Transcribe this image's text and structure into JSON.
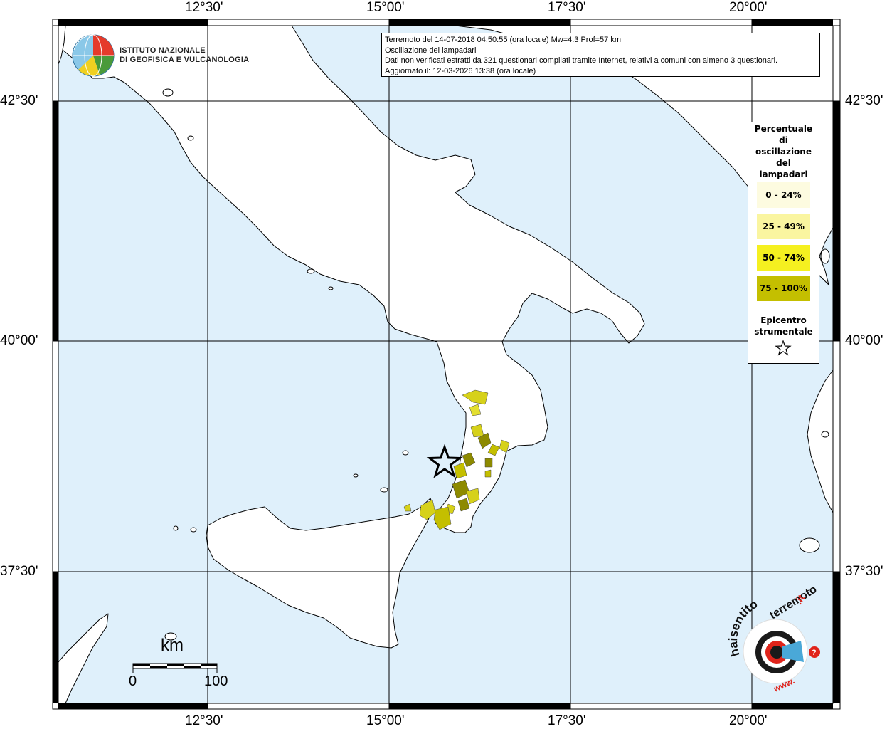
{
  "header": {
    "line1": "Terremoto del 14-07-2018 04:50:55 (ora locale) Mw=4.3 Prof=57 km",
    "line2": "Oscillazione dei lampadari",
    "line3": "Dati non verificati estratti da 321 questionari compilati tramite Internet, relativi a comuni con almeno 3 questionari.",
    "line4": "Aggiornato il: 12-03-2026 13:38 (ora locale)"
  },
  "institute": {
    "name_line1": "ISTITUTO NAZIONALE",
    "name_line2": "DI GEOFISICA E VULCANOLOGIA"
  },
  "axes": {
    "lon_labels": [
      "12°30'",
      "15°00'",
      "17°30'",
      "20°00'"
    ],
    "lat_labels": [
      "42°30'",
      "40°00'",
      "37°30'"
    ]
  },
  "legend": {
    "title": [
      "Percentuale",
      "di",
      "oscillazione",
      "del",
      "lampadari"
    ],
    "classes": [
      {
        "label": "0 - 24%",
        "color": "#fdfbe0"
      },
      {
        "label": "25 - 49%",
        "color": "#faf5a0"
      },
      {
        "label": "50 - 74%",
        "color": "#f5f020"
      },
      {
        "label": "75 - 100%",
        "color": "#c4bf00"
      }
    ],
    "epicenter_title": [
      "Epicentro",
      "strumentale"
    ]
  },
  "scale_bar": {
    "unit": "km",
    "start": "0",
    "end": "100"
  },
  "colors": {
    "sea": "#dff0fb",
    "land": "#ffffff",
    "coast": "#000000"
  },
  "icons": {
    "epicenter": "star-icon",
    "logo": "ingv-globe-icon",
    "site_logo": "haisentito-logo-icon"
  }
}
